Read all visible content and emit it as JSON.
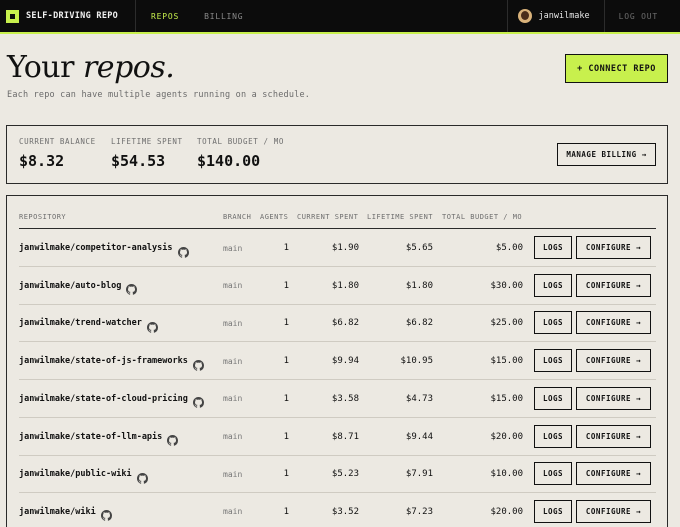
{
  "app": {
    "brand": "SELF-DRIVING REPO",
    "nav": [
      {
        "label": "REPOS",
        "active": true
      },
      {
        "label": "BILLING",
        "active": false
      }
    ],
    "username": "janwilmake",
    "logout_label": "LOG OUT",
    "accent_color": "#c8f04d"
  },
  "page": {
    "title_regular": "Your ",
    "title_italic": "repos.",
    "subtitle": "Each repo can have multiple agents running on a schedule.",
    "connect_label": "+ CONNECT REPO"
  },
  "balance": {
    "current_label": "CURRENT BALANCE",
    "current_value": "$8.32",
    "lifetime_label": "LIFETIME SPENT",
    "lifetime_value": "$54.53",
    "budget_label": "TOTAL BUDGET / MO",
    "budget_value": "$140.00",
    "manage_label": "MANAGE BILLING →"
  },
  "table": {
    "headers": {
      "repository": "REPOSITORY",
      "branch": "BRANCH",
      "agents": "AGENTS",
      "current": "CURRENT SPENT",
      "lifetime": "LIFETIME SPENT",
      "budget": "TOTAL BUDGET / MO"
    },
    "logs_label": "LOGS",
    "configure_label": "CONFIGURE →",
    "rows": [
      {
        "repo": "janwilmake/competitor-analysis",
        "branch": "main",
        "agents": "1",
        "current": "$1.90",
        "lifetime": "$5.65",
        "budget": "$5.00"
      },
      {
        "repo": "janwilmake/auto-blog",
        "branch": "main",
        "agents": "1",
        "current": "$1.80",
        "lifetime": "$1.80",
        "budget": "$30.00"
      },
      {
        "repo": "janwilmake/trend-watcher",
        "branch": "main",
        "agents": "1",
        "current": "$6.82",
        "lifetime": "$6.82",
        "budget": "$25.00"
      },
      {
        "repo": "janwilmake/state-of-js-frameworks",
        "branch": "main",
        "agents": "1",
        "current": "$9.94",
        "lifetime": "$10.95",
        "budget": "$15.00"
      },
      {
        "repo": "janwilmake/state-of-cloud-pricing",
        "branch": "main",
        "agents": "1",
        "current": "$3.58",
        "lifetime": "$4.73",
        "budget": "$15.00"
      },
      {
        "repo": "janwilmake/state-of-llm-apis",
        "branch": "main",
        "agents": "1",
        "current": "$8.71",
        "lifetime": "$9.44",
        "budget": "$20.00"
      },
      {
        "repo": "janwilmake/public-wiki",
        "branch": "main",
        "agents": "1",
        "current": "$5.23",
        "lifetime": "$7.91",
        "budget": "$10.00"
      },
      {
        "repo": "janwilmake/wiki",
        "branch": "main",
        "agents": "1",
        "current": "$3.52",
        "lifetime": "$7.23",
        "budget": "$20.00"
      }
    ]
  }
}
